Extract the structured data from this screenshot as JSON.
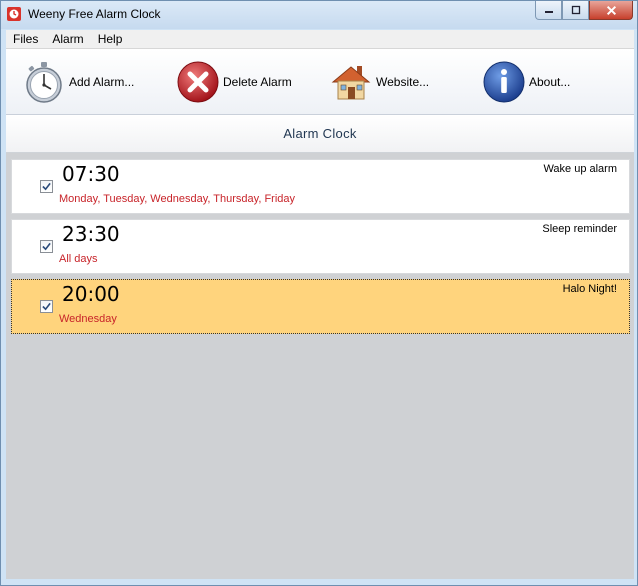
{
  "window": {
    "title": "Weeny Free Alarm Clock",
    "controls": {
      "minimize": "▭",
      "maximize": "▢",
      "close": "✕"
    }
  },
  "menu": {
    "items": [
      "Files",
      "Alarm",
      "Help"
    ]
  },
  "toolbar": {
    "add_label": "Add Alarm...",
    "delete_label": "Delete Alarm",
    "website_label": "Website...",
    "about_label": "About..."
  },
  "header": {
    "title": "Alarm  Clock"
  },
  "alarms": [
    {
      "time": "07:30",
      "days": "Monday, Tuesday, Wednesday, Thursday, Friday",
      "note": "Wake up alarm",
      "checked": true,
      "selected": false
    },
    {
      "time": "23:30",
      "days": "All days",
      "note": "Sleep reminder",
      "checked": true,
      "selected": false
    },
    {
      "time": "20:00",
      "days": "Wednesday",
      "note": "Halo Night!",
      "checked": true,
      "selected": true
    }
  ],
  "icons": {
    "add": "stopwatch-icon",
    "delete": "delete-x-icon",
    "website": "house-icon",
    "about": "info-icon"
  },
  "colors": {
    "day_text": "#c8242a",
    "selected_row": "#ffd47d",
    "list_bg": "#cfd1d4"
  }
}
